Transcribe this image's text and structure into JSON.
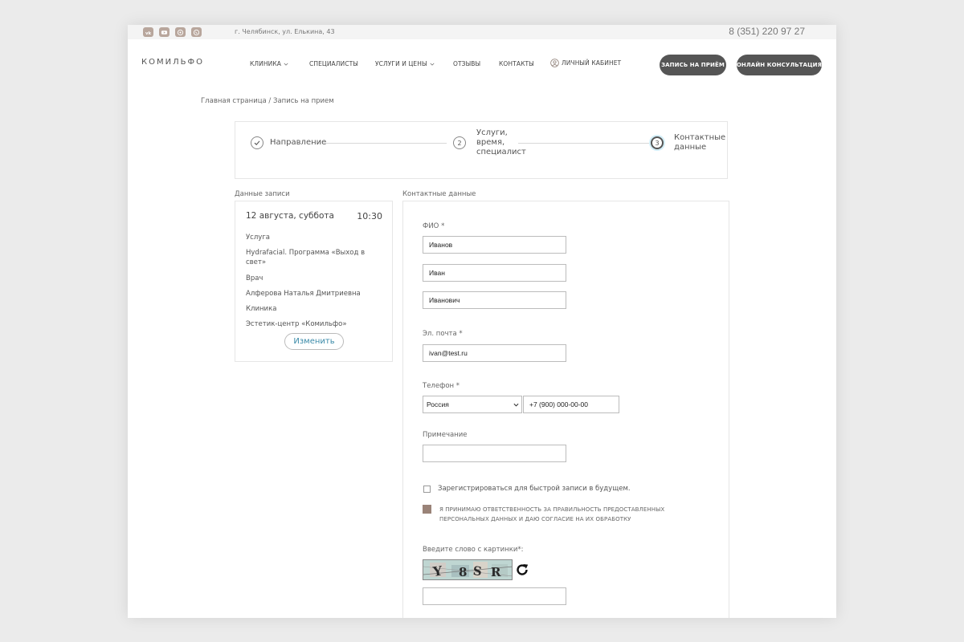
{
  "topbar": {
    "social_icons": [
      "vk-icon",
      "youtube-icon",
      "viber-icon",
      "whatsapp-icon"
    ],
    "address": "г. Челябинск, ул. Елькина, 43",
    "phone": "8 (351) 220 97 27"
  },
  "header": {
    "logo": "КОМИЛЬФО",
    "nav": {
      "clinic": "КЛИНИКА",
      "specialists": "СПЕЦИАЛИСТЫ",
      "services": "УСЛУГИ И ЦЕНЫ",
      "reviews": "ОТЗЫВЫ",
      "contacts": "КОНТАКТЫ",
      "cabinet": "ЛИЧНЫЙ КАБИНЕТ"
    },
    "book_button": "ЗАПИСЬ НА ПРИЁМ",
    "online_button": "ОНЛАЙН КОНСУЛЬТАЦИЯ"
  },
  "breadcrumb": "Главная страница / Запись на прием",
  "stepper": {
    "step1": {
      "label": "Направление"
    },
    "step2": {
      "number": "2",
      "line1": "Услуги,",
      "line2": "время,",
      "line3": "специалист"
    },
    "step3": {
      "number": "3",
      "line1": "Контактные",
      "line2": "данные"
    }
  },
  "summary": {
    "title": "Данные записи",
    "date": "12 августа, суббота",
    "time": "10:30",
    "service_label": "Услуга",
    "service_value": "Hydrafacial. Программа «Выход в свет»",
    "doctor_label": "Врач",
    "doctor_value": "Алферова Наталья Дмитриевна",
    "clinic_label": "Клиника",
    "clinic_value": "Эстетик-центр «Комильфо»",
    "edit_button": "Изменить"
  },
  "contact": {
    "title": "Контактные данные",
    "fio_label": "ФИО *",
    "last_name": "Иванов",
    "first_name": "Иван",
    "middle_name": "Иванович",
    "email_label": "Эл. почта *",
    "email": "ivan@test.ru",
    "phone_label": "Телефон *",
    "country": "Россия",
    "phone": "+7 (900) 000-00-00",
    "note_label": "Примечание",
    "note": "",
    "register_label": "Зарегистрироваться для быстрой записи в будущем.",
    "register_checked": false,
    "consent_label": "Я ПРИНИМАЮ ОТВЕТСТВЕННОСТЬ ЗА ПРАВИЛЬНОСТЬ ПРЕДОСТАВЛЕННЫХ ПЕРСОНАЛЬНЫХ ДАННЫХ И ДАЮ СОГЛАСИЕ НА ИХ ОБРАБОТКУ",
    "consent_checked": true,
    "captcha_label": "Введите слово с картинки*:",
    "captcha_text": "Y8SR",
    "captcha_input": ""
  },
  "colors": {
    "accent": "#3a8aa8",
    "dark_button": "#555555",
    "social": "#b8a69c",
    "checkbox": "#9a8378"
  }
}
